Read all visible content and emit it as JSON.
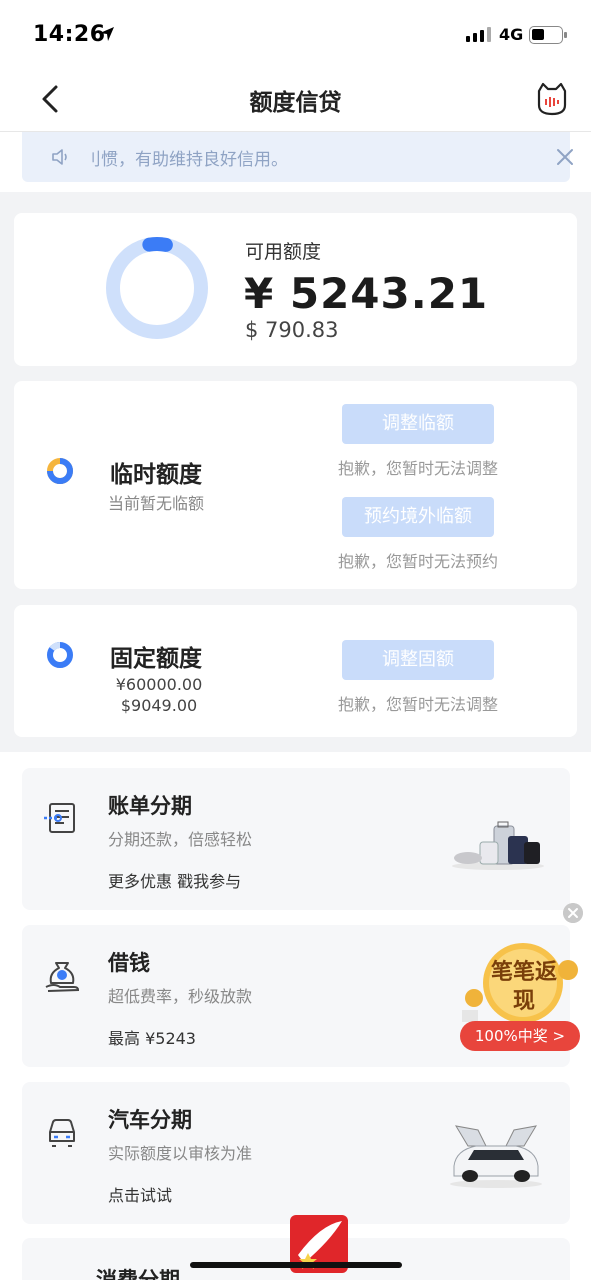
{
  "status_bar": {
    "time": "14:26",
    "network": "4G"
  },
  "nav": {
    "title": "额度信贷"
  },
  "notice": {
    "text": "刂惯，有助维持良好信用。"
  },
  "available": {
    "label": "可用额度",
    "amount": "¥ 5243.21",
    "usd": "$ 790.83",
    "used_fraction": 0.06
  },
  "temp_quota": {
    "title": "临时额度",
    "subtitle": "当前暂无临额",
    "adjust_button": "调整临额",
    "adjust_hint": "抱歉，您暂时无法调整",
    "reserve_button": "预约境外临额",
    "reserve_hint": "抱歉，您暂时无法预约"
  },
  "fixed_quota": {
    "title": "固定额度",
    "amount_cny": "¥60000.00",
    "amount_usd": "$9049.00",
    "adjust_button": "调整固额",
    "adjust_hint": "抱歉，您暂时无法调整"
  },
  "services": [
    {
      "title": "账单分期",
      "subtitle": "分期还款，倍感轻松",
      "cta": "更多优惠 戳我参与",
      "icon": "bill-installment-icon"
    },
    {
      "title": "借钱",
      "subtitle": "超低费率，秒级放款",
      "cta": "最高 ¥5243",
      "icon": "money-bag-icon"
    },
    {
      "title": "汽车分期",
      "subtitle": "实际额度以审核为准",
      "cta": "点击试试",
      "icon": "car-icon"
    },
    {
      "title": "消费分期"
    }
  ],
  "promo": {
    "text": "笔笔返现",
    "pill": "100%中奖 >"
  },
  "colors": {
    "accent": "#3b7cf6",
    "disabled_button": "#c9dcfa",
    "ring_track": "#cfe0fb",
    "promo_red": "#e8453c"
  }
}
